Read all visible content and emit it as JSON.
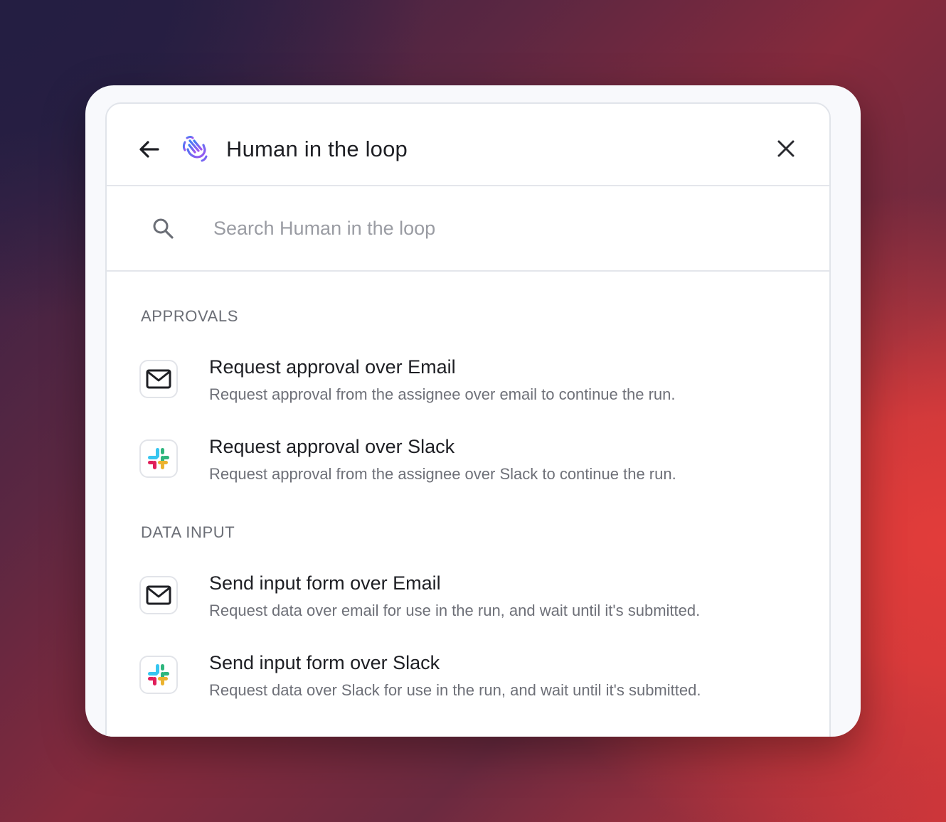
{
  "header": {
    "title": "Human in the loop",
    "back_icon": "arrow-left-icon",
    "app_icon": "hand-wave-icon",
    "close_icon": "close-icon"
  },
  "search": {
    "placeholder": "Search Human in the loop",
    "value": "",
    "icon": "search-icon"
  },
  "sections": [
    {
      "label": "APPROVALS",
      "items": [
        {
          "title": "Request approval over Email",
          "description": "Request approval from the assignee over email to continue the run.",
          "icon": "email-icon"
        },
        {
          "title": "Request approval over Slack",
          "description": "Request approval from the assignee over Slack to continue the run.",
          "icon": "slack-icon"
        }
      ]
    },
    {
      "label": "DATA INPUT",
      "items": [
        {
          "title": "Send input form over Email",
          "description": "Request data over email for use in the run, and wait until it's submitted.",
          "icon": "email-icon"
        },
        {
          "title": "Send input form over Slack",
          "description": "Request data over Slack for use in the run, and wait until it's submitted.",
          "icon": "slack-icon"
        }
      ]
    }
  ],
  "colors": {
    "accent_blue": "#4a6cf7",
    "accent_purple": "#9b5cf0",
    "slack_blue": "#36c5f0",
    "slack_green": "#2eb67d",
    "slack_yellow": "#ecb22e",
    "slack_red": "#e01e5a"
  }
}
